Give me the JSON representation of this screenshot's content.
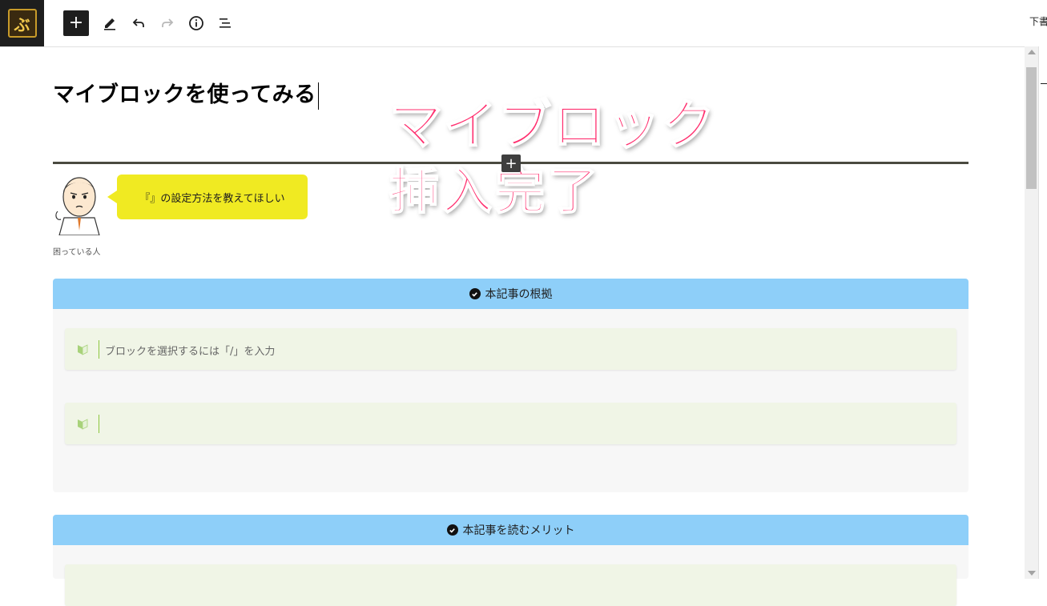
{
  "toolbar": {
    "logo_text": "ぶ",
    "add_label": "+",
    "right_text": "下書"
  },
  "post": {
    "title": "マイブロックを使ってみる"
  },
  "overlay": {
    "line1": "マイブロック",
    "line2": "挿入完了"
  },
  "separator": {
    "add_label": "+"
  },
  "balloon": {
    "text": "『』の設定方法を教えてほしい",
    "name": "困っている人"
  },
  "boxes": [
    {
      "title": "本記事の根拠",
      "placeholder": "ブロックを選択するには「/」を入力"
    },
    {
      "title": "本記事を読むメリット"
    }
  ],
  "colors": {
    "overlay_pink": "#ff2e6e",
    "box_header_blue": "#8ecff9",
    "balloon_yellow": "#f0ea22",
    "inner_green": "#f0f5e6"
  }
}
